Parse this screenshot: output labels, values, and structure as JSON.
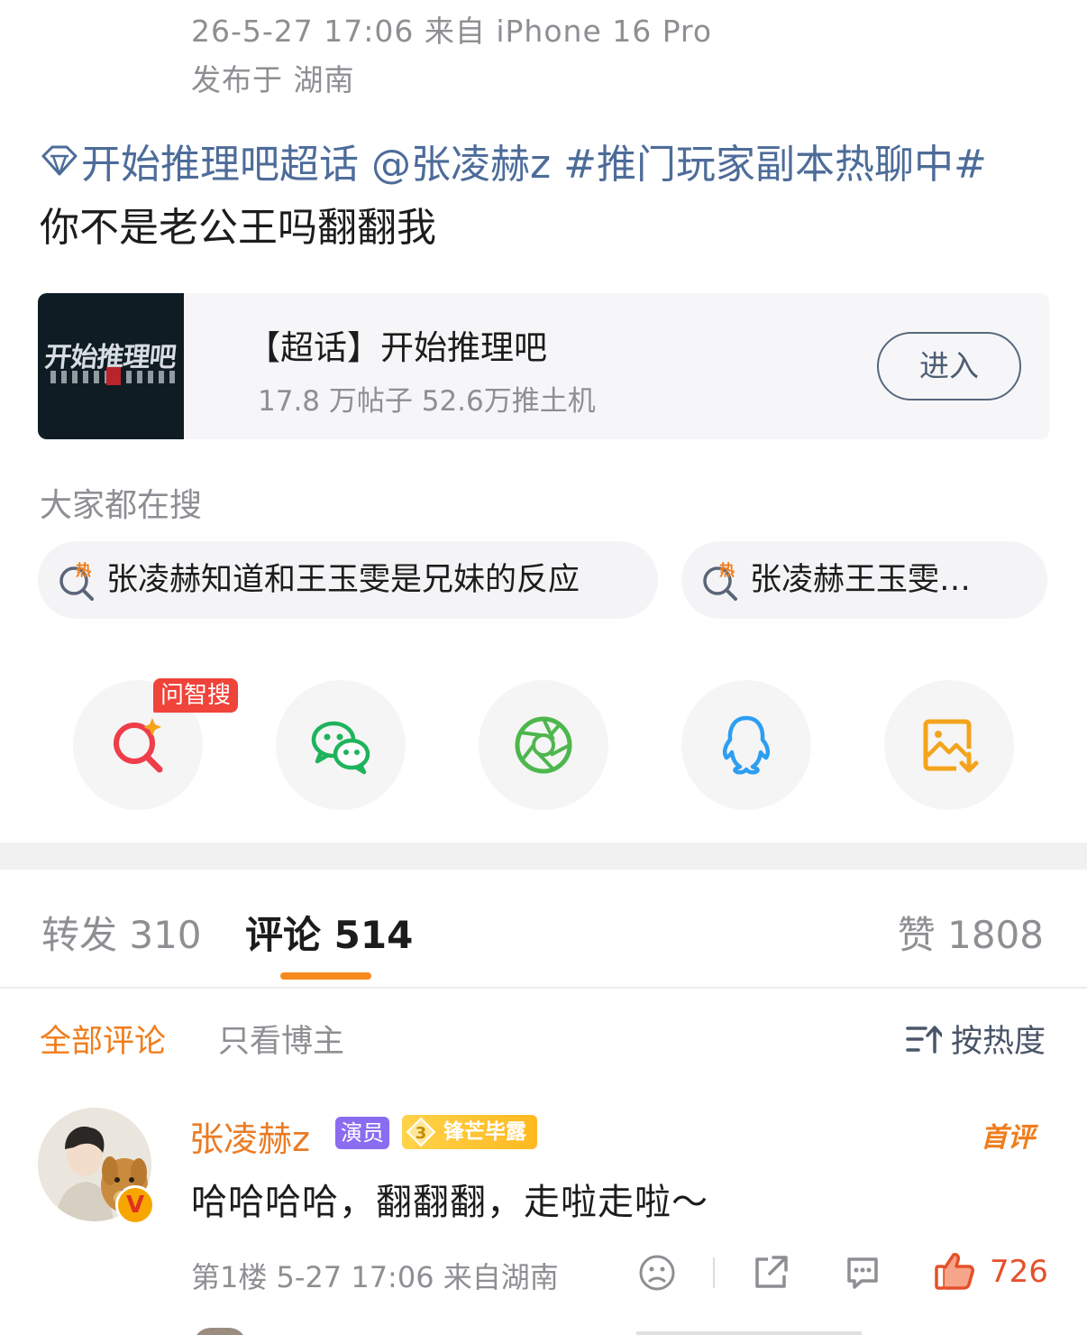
{
  "post": {
    "time_source": "26-5-27 17:06  来自 iPhone 16 Pro",
    "location": "发布于 湖南",
    "supertopic": "开始推理吧超话",
    "mention": "@张凌赫z",
    "hashtag": "#推门玩家副本热聊中#",
    "body": "你不是老公王吗翻翻我"
  },
  "topic_card": {
    "thumb_text": "开始推理吧",
    "title": "【超话】开始推理吧",
    "stats": "17.8 万帖子 52.6万推土机",
    "enter_label": "进入"
  },
  "search": {
    "heading": "大家都在搜",
    "chips": [
      "张凌赫知道和王玉雯是兄妹的反应",
      "张凌赫王玉雯…"
    ]
  },
  "share": {
    "ask_badge": "问智搜",
    "icons": [
      "ask-search-icon",
      "wechat-icon",
      "moments-icon",
      "qq-icon",
      "save-image-icon"
    ]
  },
  "tabs": {
    "repost": "转发 310",
    "comment": "评论 514",
    "like": "赞 1808"
  },
  "filters": {
    "all": "全部评论",
    "author_only": "只看博主",
    "sort": "按热度"
  },
  "comment": {
    "name": "张凌赫z",
    "role_badge": "演员",
    "level": "3",
    "fan_badge": "锋芒毕露",
    "first_tag": "首评",
    "verified_mark": "V",
    "text": "哈哈哈哈，翻翻翻，走啦走啦～",
    "meta": "第1楼 5-27 17:06 来自湖南",
    "likes": "726"
  },
  "colors": {
    "link": "#4d6c99",
    "accent_orange": "#f07d1b",
    "like_red": "#e5502a",
    "ask_badge": "#f0433a"
  }
}
